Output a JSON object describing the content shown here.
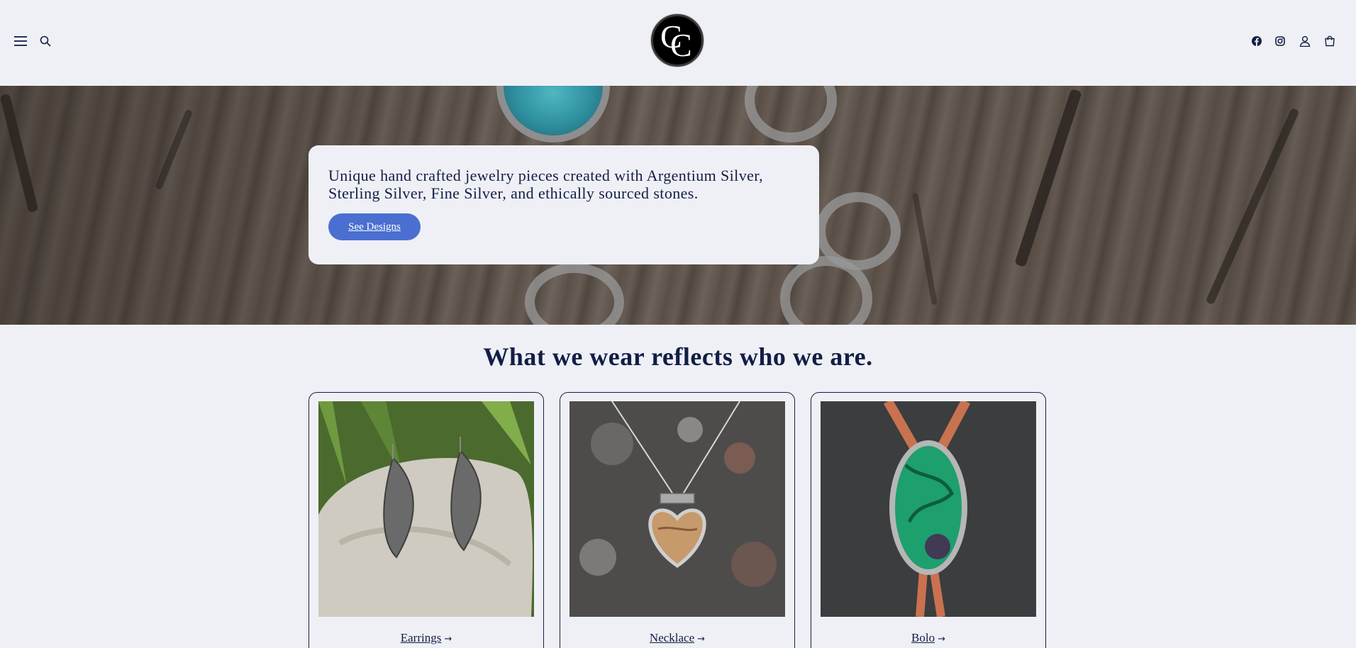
{
  "header": {
    "logo_text": "CC",
    "icons": {
      "menu": "hamburger-icon",
      "search": "search-icon",
      "facebook": "facebook-icon",
      "instagram": "instagram-icon",
      "account": "account-icon",
      "cart": "cart-icon"
    }
  },
  "hero": {
    "text": "Unique hand crafted jewelry pieces created with Argentium Silver, Sterling Silver, Fine Silver, and ethically sourced stones.",
    "button_label": "See Designs"
  },
  "collections": {
    "heading": "What we wear reflects who we are.",
    "items": [
      {
        "label": "Earrings",
        "arrow": "→"
      },
      {
        "label": "Necklace",
        "arrow": "→"
      },
      {
        "label": "Bolo",
        "arrow": "→"
      }
    ]
  },
  "colors": {
    "background": "#eff0f5",
    "text": "#121e45",
    "button": "#4a6fd0"
  }
}
